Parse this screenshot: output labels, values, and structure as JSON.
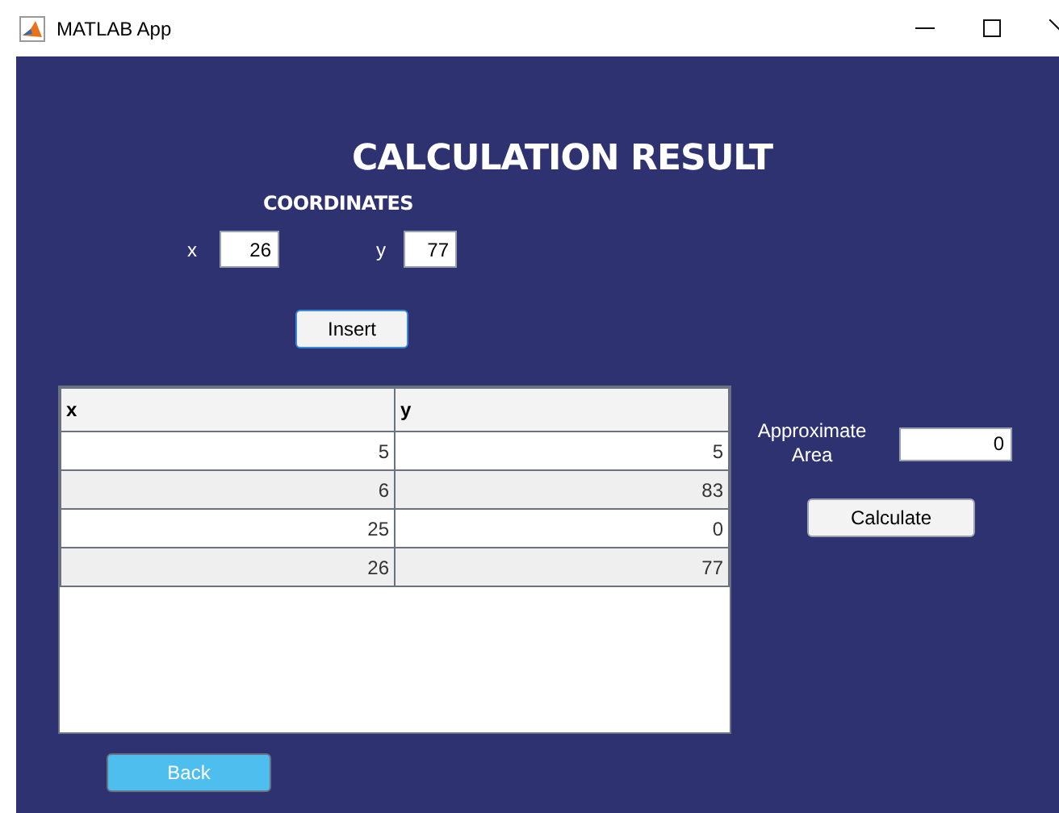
{
  "window": {
    "title": "MATLAB App"
  },
  "heading": "CALCULATION RESULT",
  "coordinates": {
    "label": "COORDINATES",
    "x_label": "x",
    "x_value": "26",
    "y_label": "y",
    "y_value": "77"
  },
  "insert_button": "Insert",
  "table": {
    "columns": [
      "x",
      "y"
    ],
    "rows": [
      [
        "5",
        "5"
      ],
      [
        "6",
        "83"
      ],
      [
        "25",
        "0"
      ],
      [
        "26",
        "77"
      ]
    ]
  },
  "area": {
    "label": "Approximate Area",
    "value": "0"
  },
  "calculate_button": "Calculate",
  "back_button": "Back"
}
